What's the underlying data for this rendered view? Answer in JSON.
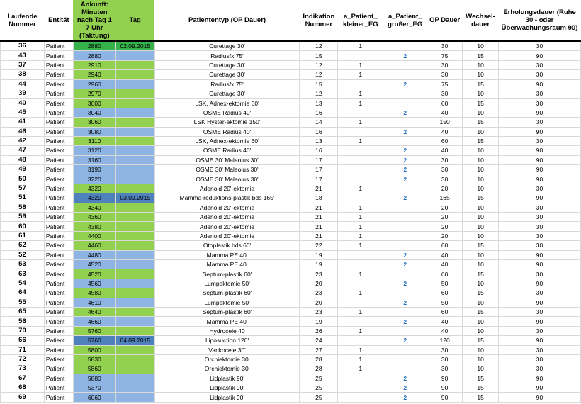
{
  "columns": {
    "lfd": "Laufende Nummer",
    "ent": "Entität",
    "ank": "Ankunft: Minuten nach Tag 1 7 Uhr (Taktung)",
    "tag": "Tag",
    "typ": "Patiententyp (OP Dauer)",
    "ind": "Indikation Nummer",
    "ak": "a_Patient_ kleiner_EG",
    "ag": "a_Patient_ großer_EG",
    "opd": "OP Dauer",
    "wd": "Wechsel- dauer",
    "ed": "Erholungsdauer (Ruhe 30 - oder Überwachungsraum 90)"
  },
  "colors": {
    "green": "#92d050",
    "blue": "#8db4e2",
    "dark_green": "#35b34a",
    "dark_blue": "#4f81bd",
    "accent_text": "#1f6fc0"
  },
  "rows": [
    {
      "lfd": "36",
      "ent": "Patient",
      "ank": "2880",
      "tag": "02.09.2015",
      "typ": "Curettage 30'",
      "ind": "12",
      "ak": "1",
      "ag": "",
      "opd": "30",
      "wd": "10",
      "ed": "30",
      "c": "dg"
    },
    {
      "lfd": "43",
      "ent": "Patient",
      "ank": "2880",
      "tag": "",
      "typ": "Radiusfx 75'",
      "ind": "15",
      "ak": "",
      "ag": "2",
      "opd": "75",
      "wd": "15",
      "ed": "90",
      "c": "b"
    },
    {
      "lfd": "37",
      "ent": "Patient",
      "ank": "2910",
      "tag": "",
      "typ": "Curettage 30'",
      "ind": "12",
      "ak": "1",
      "ag": "",
      "opd": "30",
      "wd": "10",
      "ed": "30",
      "c": "g"
    },
    {
      "lfd": "38",
      "ent": "Patient",
      "ank": "2940",
      "tag": "",
      "typ": "Curettage 30'",
      "ind": "12",
      "ak": "1",
      "ag": "",
      "opd": "30",
      "wd": "10",
      "ed": "30",
      "c": "g"
    },
    {
      "lfd": "44",
      "ent": "Patient",
      "ank": "2960",
      "tag": "",
      "typ": "Radiusfx 75'",
      "ind": "15",
      "ak": "",
      "ag": "2",
      "opd": "75",
      "wd": "15",
      "ed": "90",
      "c": "b"
    },
    {
      "lfd": "39",
      "ent": "Patient",
      "ank": "2970",
      "tag": "",
      "typ": "Curettage 30'",
      "ind": "12",
      "ak": "1",
      "ag": "",
      "opd": "30",
      "wd": "10",
      "ed": "30",
      "c": "g"
    },
    {
      "lfd": "40",
      "ent": "Patient",
      "ank": "3000",
      "tag": "",
      "typ": "LSK, Adnex-ektomie 60'",
      "ind": "13",
      "ak": "1",
      "ag": "",
      "opd": "60",
      "wd": "15",
      "ed": "30",
      "c": "g"
    },
    {
      "lfd": "45",
      "ent": "Patient",
      "ank": "3040",
      "tag": "",
      "typ": "OSME Radius 40'",
      "ind": "16",
      "ak": "",
      "ag": "2",
      "opd": "40",
      "wd": "10",
      "ed": "90",
      "c": "b"
    },
    {
      "lfd": "41",
      "ent": "Patient",
      "ank": "3060",
      "tag": "",
      "typ": "LSK Hyster-ektomie 150'",
      "ind": "14",
      "ak": "1",
      "ag": "",
      "opd": "150",
      "wd": "15",
      "ed": "30",
      "c": "g"
    },
    {
      "lfd": "46",
      "ent": "Patient",
      "ank": "3080",
      "tag": "",
      "typ": "OSME Radius 40'",
      "ind": "16",
      "ak": "",
      "ag": "2",
      "opd": "40",
      "wd": "10",
      "ed": "90",
      "c": "b"
    },
    {
      "lfd": "42",
      "ent": "Patient",
      "ank": "3110",
      "tag": "",
      "typ": "LSK, Adnex-ektomie 60'",
      "ind": "13",
      "ak": "1",
      "ag": "",
      "opd": "60",
      "wd": "15",
      "ed": "30",
      "c": "g"
    },
    {
      "lfd": "47",
      "ent": "Patient",
      "ank": "3120",
      "tag": "",
      "typ": "OSME Radius 40'",
      "ind": "16",
      "ak": "",
      "ag": "2",
      "opd": "40",
      "wd": "10",
      "ed": "90",
      "c": "b"
    },
    {
      "lfd": "48",
      "ent": "Patient",
      "ank": "3160",
      "tag": "",
      "typ": "OSME 30' Maleolus 30'",
      "ind": "17",
      "ak": "",
      "ag": "2",
      "opd": "30",
      "wd": "10",
      "ed": "90",
      "c": "b"
    },
    {
      "lfd": "49",
      "ent": "Patient",
      "ank": "3190",
      "tag": "",
      "typ": "OSME 30' Maleolus 30'",
      "ind": "17",
      "ak": "",
      "ag": "2",
      "opd": "30",
      "wd": "10",
      "ed": "90",
      "c": "b"
    },
    {
      "lfd": "50",
      "ent": "Patient",
      "ank": "3220",
      "tag": "",
      "typ": "OSME 30' Maleolus 30'",
      "ind": "17",
      "ak": "",
      "ag": "2",
      "opd": "30",
      "wd": "10",
      "ed": "90",
      "c": "b"
    },
    {
      "lfd": "57",
      "ent": "Patient",
      "ank": "4320",
      "tag": "",
      "typ": "Adenoid 20'-ektomie",
      "ind": "21",
      "ak": "1",
      "ag": "",
      "opd": "20",
      "wd": "10",
      "ed": "30",
      "c": "g"
    },
    {
      "lfd": "51",
      "ent": "Patient",
      "ank": "4320",
      "tag": "03.09.2015",
      "typ": "Mamma-reduktions-plastik bds 165'",
      "ind": "18",
      "ak": "",
      "ag": "2",
      "opd": "165",
      "wd": "15",
      "ed": "90",
      "c": "db"
    },
    {
      "lfd": "58",
      "ent": "Patient",
      "ank": "4340",
      "tag": "",
      "typ": "Adenoid 20'-ektomie",
      "ind": "21",
      "ak": "1",
      "ag": "",
      "opd": "20",
      "wd": "10",
      "ed": "30",
      "c": "g"
    },
    {
      "lfd": "59",
      "ent": "Patient",
      "ank": "4360",
      "tag": "",
      "typ": "Adenoid 20'-ektomie",
      "ind": "21",
      "ak": "1",
      "ag": "",
      "opd": "20",
      "wd": "10",
      "ed": "30",
      "c": "g"
    },
    {
      "lfd": "60",
      "ent": "Patient",
      "ank": "4380",
      "tag": "",
      "typ": "Adenoid 20'-ektomie",
      "ind": "21",
      "ak": "1",
      "ag": "",
      "opd": "20",
      "wd": "10",
      "ed": "30",
      "c": "g"
    },
    {
      "lfd": "61",
      "ent": "Patient",
      "ank": "4400",
      "tag": "",
      "typ": "Adenoid 20'-ektomie",
      "ind": "21",
      "ak": "1",
      "ag": "",
      "opd": "20",
      "wd": "10",
      "ed": "30",
      "c": "g"
    },
    {
      "lfd": "62",
      "ent": "Patient",
      "ank": "4460",
      "tag": "",
      "typ": "Otoplastik bds 60'",
      "ind": "22",
      "ak": "1",
      "ag": "",
      "opd": "60",
      "wd": "15",
      "ed": "30",
      "c": "g"
    },
    {
      "lfd": "52",
      "ent": "Patient",
      "ank": "4480",
      "tag": "",
      "typ": "Mamma PE 40'",
      "ind": "19",
      "ak": "",
      "ag": "2",
      "opd": "40",
      "wd": "10",
      "ed": "90",
      "c": "b"
    },
    {
      "lfd": "53",
      "ent": "Patient",
      "ank": "4520",
      "tag": "",
      "typ": "Mamma PE 40'",
      "ind": "19",
      "ak": "",
      "ag": "2",
      "opd": "40",
      "wd": "10",
      "ed": "90",
      "c": "b"
    },
    {
      "lfd": "63",
      "ent": "Patient",
      "ank": "4520",
      "tag": "",
      "typ": "Septum-plastik 60'",
      "ind": "23",
      "ak": "1",
      "ag": "",
      "opd": "60",
      "wd": "15",
      "ed": "30",
      "c": "g"
    },
    {
      "lfd": "54",
      "ent": "Patient",
      "ank": "4560",
      "tag": "",
      "typ": "Lumpektomie 50'",
      "ind": "20",
      "ak": "",
      "ag": "2",
      "opd": "50",
      "wd": "10",
      "ed": "90",
      "c": "b"
    },
    {
      "lfd": "64",
      "ent": "Patient",
      "ank": "4580",
      "tag": "",
      "typ": "Septum-plastik 60'",
      "ind": "23",
      "ak": "1",
      "ag": "",
      "opd": "60",
      "wd": "15",
      "ed": "30",
      "c": "g"
    },
    {
      "lfd": "55",
      "ent": "Patient",
      "ank": "4610",
      "tag": "",
      "typ": "Lumpektomie 50'",
      "ind": "20",
      "ak": "",
      "ag": "2",
      "opd": "50",
      "wd": "10",
      "ed": "90",
      "c": "b"
    },
    {
      "lfd": "65",
      "ent": "Patient",
      "ank": "4640",
      "tag": "",
      "typ": "Septum-plastik 60'",
      "ind": "23",
      "ak": "1",
      "ag": "",
      "opd": "60",
      "wd": "15",
      "ed": "30",
      "c": "g"
    },
    {
      "lfd": "56",
      "ent": "Patient",
      "ank": "4660",
      "tag": "",
      "typ": "Mamma PE 40'",
      "ind": "19",
      "ak": "",
      "ag": "2",
      "opd": "40",
      "wd": "10",
      "ed": "90",
      "c": "b"
    },
    {
      "lfd": "70",
      "ent": "Patient",
      "ank": "5760",
      "tag": "",
      "typ": "Hydrocele 40",
      "ind": "26",
      "ak": "1",
      "ag": "",
      "opd": "40",
      "wd": "10",
      "ed": "30",
      "c": "g"
    },
    {
      "lfd": "66",
      "ent": "Patient",
      "ank": "5760",
      "tag": "04.09.2015",
      "typ": "Liposuction 120'",
      "ind": "24",
      "ak": "",
      "ag": "2",
      "opd": "120",
      "wd": "15",
      "ed": "90",
      "c": "db"
    },
    {
      "lfd": "71",
      "ent": "Patient",
      "ank": "5800",
      "tag": "",
      "typ": "Varikocele 30'",
      "ind": "27",
      "ak": "1",
      "ag": "",
      "opd": "30",
      "wd": "10",
      "ed": "30",
      "c": "g"
    },
    {
      "lfd": "72",
      "ent": "Patient",
      "ank": "5830",
      "tag": "",
      "typ": "Orchiektomie 30'",
      "ind": "28",
      "ak": "1",
      "ag": "",
      "opd": "30",
      "wd": "10",
      "ed": "30",
      "c": "g"
    },
    {
      "lfd": "73",
      "ent": "Patient",
      "ank": "5860",
      "tag": "",
      "typ": "Orchiektomie 30'",
      "ind": "28",
      "ak": "1",
      "ag": "",
      "opd": "30",
      "wd": "10",
      "ed": "30",
      "c": "g"
    },
    {
      "lfd": "67",
      "ent": "Patient",
      "ank": "5880",
      "tag": "",
      "typ": "Lidplastik 90'",
      "ind": "25",
      "ak": "",
      "ag": "2",
      "opd": "90",
      "wd": "15",
      "ed": "90",
      "c": "b"
    },
    {
      "lfd": "68",
      "ent": "Patient",
      "ank": "5370",
      "tag": "",
      "typ": "Lidplastik 90'",
      "ind": "25",
      "ak": "",
      "ag": "2",
      "opd": "90",
      "wd": "15",
      "ed": "90",
      "c": "b"
    },
    {
      "lfd": "69",
      "ent": "Patient",
      "ank": "6060",
      "tag": "",
      "typ": "Lidplastik 90'",
      "ind": "25",
      "ak": "",
      "ag": "2",
      "opd": "90",
      "wd": "15",
      "ed": "90",
      "c": "b"
    }
  ]
}
